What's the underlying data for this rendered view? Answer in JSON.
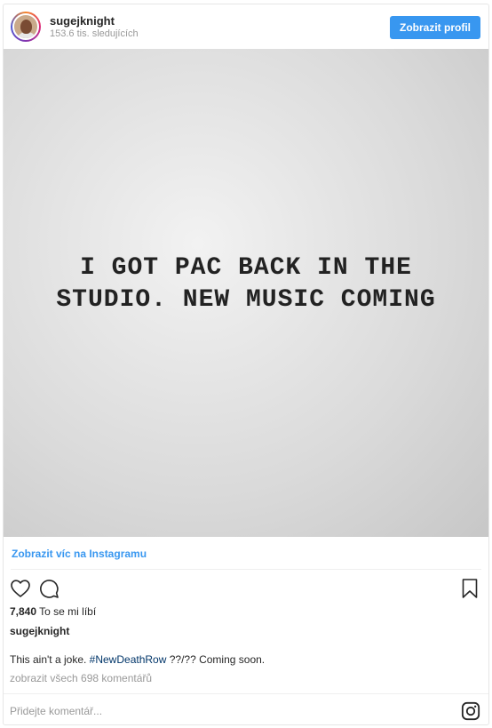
{
  "header": {
    "username": "sugejknight",
    "followers": "153.6 tis. sledujících",
    "profile_button": "Zobrazit profil"
  },
  "image": {
    "text_line1": "I GOT PAC BACK IN THE",
    "text_line2": "STUDIO. NEW MUSIC COMING"
  },
  "view_more": "Zobrazit víc na Instagramu",
  "actions": {
    "icons": [
      "heart-icon",
      "comment-icon",
      "bookmark-icon"
    ]
  },
  "likes": {
    "count": "7,840",
    "label": "To se mi líbí"
  },
  "post": {
    "author": "sugejknight",
    "caption_before": "This ain't a joke. ",
    "hashtag": "#NewDeathRow",
    "caption_after": " ??/?? Coming soon.",
    "all_comments": "zobrazit všech 698 komentářů"
  },
  "comment_box": {
    "placeholder": "Přidejte komentář..."
  },
  "colors": {
    "accent": "#3897f0",
    "hashtag": "#003569",
    "muted": "#999999"
  }
}
